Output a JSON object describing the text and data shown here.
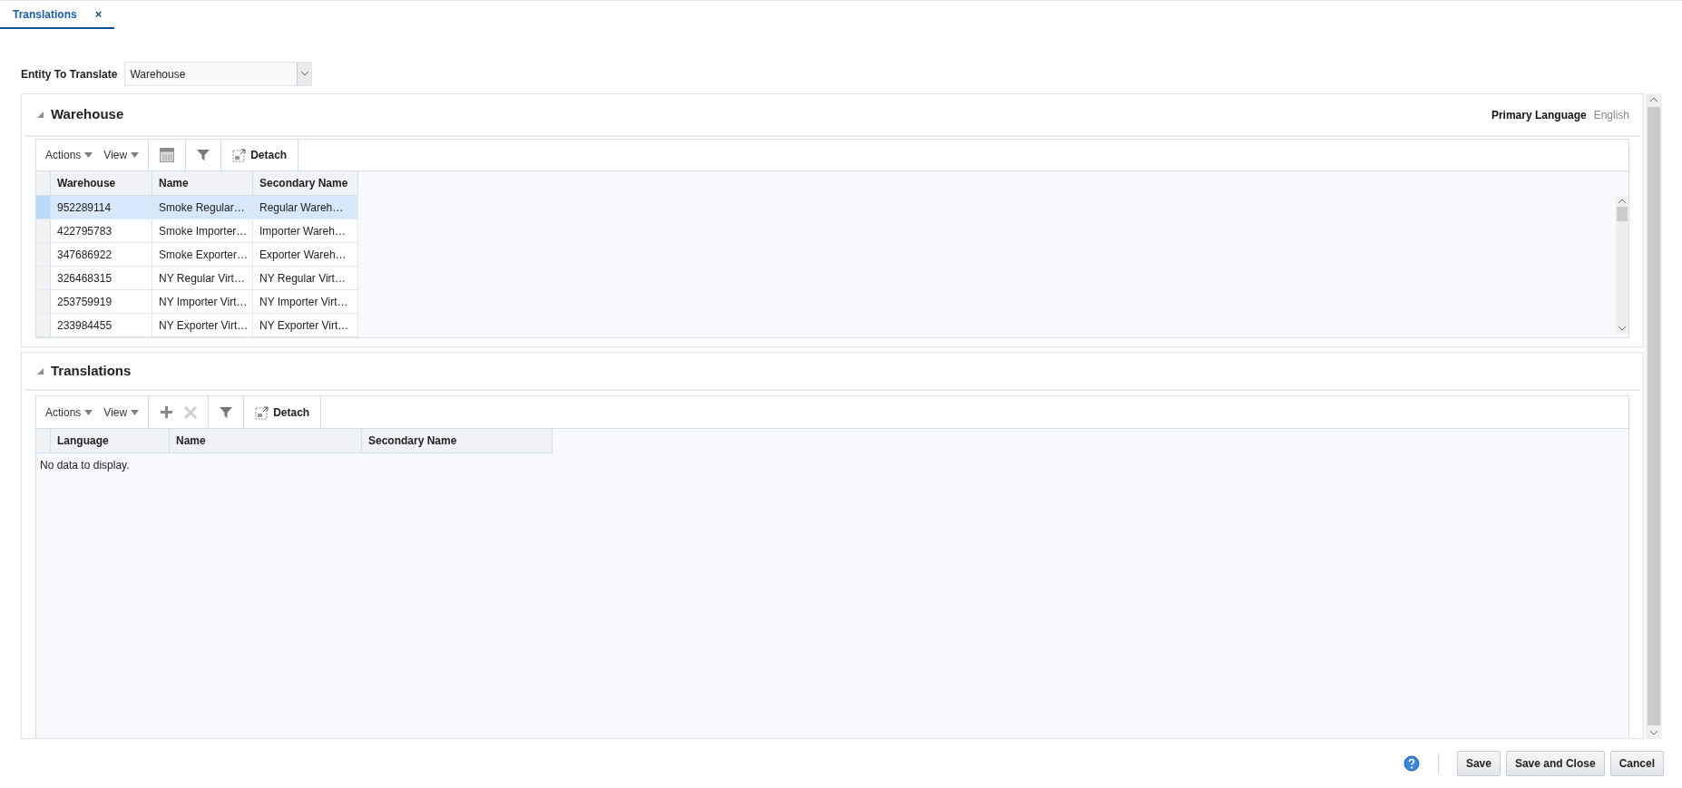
{
  "tabs": [
    {
      "label": "Translations",
      "selected": true,
      "close": "×"
    }
  ],
  "entity": {
    "label": "Entity To Translate",
    "value": "Warehouse"
  },
  "warehouse_panel": {
    "title": "Warehouse",
    "primary_language_label": "Primary Language",
    "primary_language": "English",
    "toolbar": {
      "actions": "Actions",
      "view": "View",
      "detach": "Detach"
    },
    "columns": [
      "Warehouse",
      "Name",
      "Secondary Name"
    ],
    "rows": [
      {
        "cells": [
          "952289114",
          "Smoke Regular…",
          "Regular Wareh…"
        ],
        "selected": true
      },
      {
        "cells": [
          "422795783",
          "Smoke Importer…",
          "Importer Wareh…"
        ],
        "selected": false
      },
      {
        "cells": [
          "347686922",
          "Smoke Exporter…",
          "Exporter Wareh…"
        ],
        "selected": false
      },
      {
        "cells": [
          "326468315",
          "NY Regular Virt…",
          "NY Regular Virt…"
        ],
        "selected": false
      },
      {
        "cells": [
          "253759919",
          "NY Importer Virt…",
          "NY Importer Virt…"
        ],
        "selected": false
      },
      {
        "cells": [
          "233984455",
          "NY Exporter Virt…",
          "NY Exporter Virt…"
        ],
        "selected": false
      }
    ]
  },
  "translations_panel": {
    "title": "Translations",
    "toolbar": {
      "actions": "Actions",
      "view": "View",
      "detach": "Detach"
    },
    "columns": [
      "Language",
      "Name",
      "Secondary Name"
    ],
    "empty_text": "No data to display."
  },
  "footer": {
    "buttons": [
      "Save",
      "Save and Close",
      "Cancel"
    ]
  }
}
